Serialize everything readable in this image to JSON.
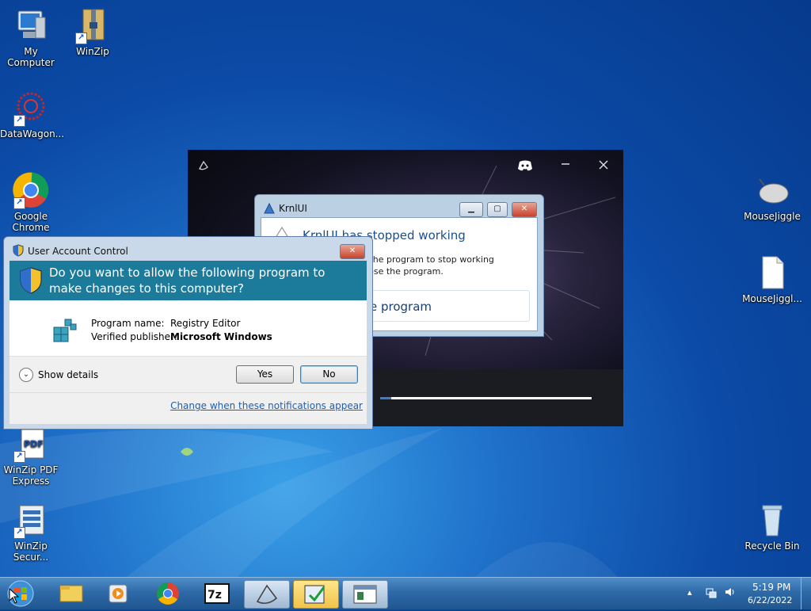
{
  "desktop_icons": [
    {
      "label": "My Computer",
      "icon": "computer-icon"
    },
    {
      "label": "WinZip",
      "icon": "winzip-icon"
    },
    {
      "label": "DataWagon...",
      "icon": "datawagon-icon"
    },
    {
      "label": "Google Chrome",
      "icon": "chrome-icon"
    },
    {
      "label": "MouseJiggle",
      "icon": "mouse-icon"
    },
    {
      "label": "MouseJiggl...",
      "icon": "file-icon"
    },
    {
      "label": "WinZip PDF Express",
      "icon": "pdf-icon"
    },
    {
      "label": "WinZip Secur...",
      "icon": "winzip-secure-icon"
    },
    {
      "label": "Recycle Bin",
      "icon": "recycle-bin-icon"
    }
  ],
  "krnl": {
    "title": "KrnlUI",
    "heading": "KrnlUI has stopped working",
    "message_line1": "d the program to stop working",
    "message_line2": "close the program.",
    "action": "e program"
  },
  "uac": {
    "title": "User Account Control",
    "question": "Do you want to allow the following program to make changes to this computer?",
    "program_name_label": "Program name:",
    "program_name": "Registry Editor",
    "publisher_label": "Verified publisher:",
    "publisher": "Microsoft Windows",
    "show_details": "Show details",
    "yes": "Yes",
    "no": "No",
    "change_link": "Change when these notifications appear"
  },
  "taskbar": {
    "items": [
      "explorer-icon",
      "media-player-icon",
      "chrome-icon",
      "7zip-icon",
      "krnl-icon",
      "registry-editor-icon",
      "window-icon"
    ],
    "time": "5:19 PM",
    "date": "6/22/2022"
  },
  "colors": {
    "uac_banner": "#1c7a9a",
    "link": "#1a5fb4",
    "desktop": "#0b4aa6"
  }
}
